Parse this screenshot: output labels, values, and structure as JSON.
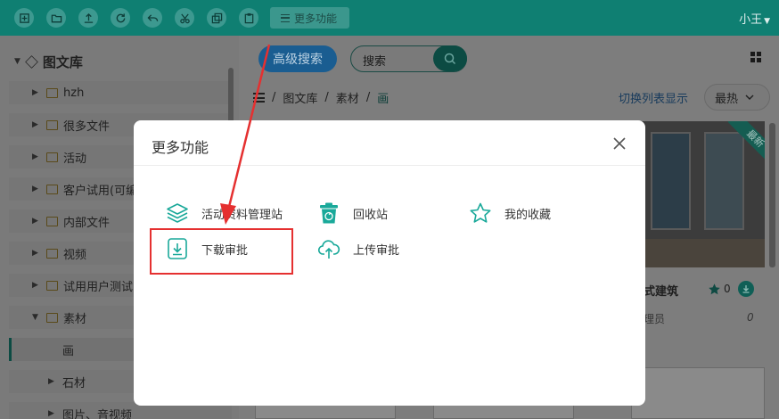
{
  "toolbar": {
    "more_label": "更多功能",
    "user_label": "小王",
    "buttons": [
      "new-icon",
      "folder-icon",
      "upload-icon",
      "refresh-icon",
      "undo-icon",
      "cut-icon",
      "copy-icon",
      "paste-icon"
    ]
  },
  "tree": {
    "root_label": "图文库",
    "items": [
      {
        "label": "hzh"
      },
      {
        "label": "很多文件"
      },
      {
        "label": "活动"
      },
      {
        "label": "客户试用(可编"
      },
      {
        "label": "内部文件"
      },
      {
        "label": "视频"
      },
      {
        "label": "试用用户测试"
      },
      {
        "label": "素材"
      },
      {
        "label": "画"
      },
      {
        "label": "石材"
      },
      {
        "label": "图片、音视频"
      }
    ]
  },
  "main": {
    "advanced_search_label": "高级搜索",
    "search_placeholder": "搜索",
    "breadcrumb": [
      "图文库",
      "素材",
      "画"
    ],
    "switch_view_label": "切换列表显示",
    "sort_value": "最热",
    "card": {
      "badge": "最新",
      "title": "式建筑",
      "favorites": "0",
      "owner": "理员",
      "number": "0"
    }
  },
  "dialog": {
    "title": "更多功能",
    "functions": [
      {
        "label": "活动资料管理站",
        "icon": "layers-icon"
      },
      {
        "label": "回收站",
        "icon": "recycle-bin-icon"
      },
      {
        "label": "我的收藏",
        "icon": "star-icon"
      },
      {
        "label": "下载审批",
        "icon": "download-approval-icon"
      },
      {
        "label": "上传审批",
        "icon": "cloud-upload-icon"
      }
    ]
  },
  "colors": {
    "brand": "#0f7f72",
    "accent_teal": "#1aa99a",
    "highlight_red": "#e53030"
  }
}
